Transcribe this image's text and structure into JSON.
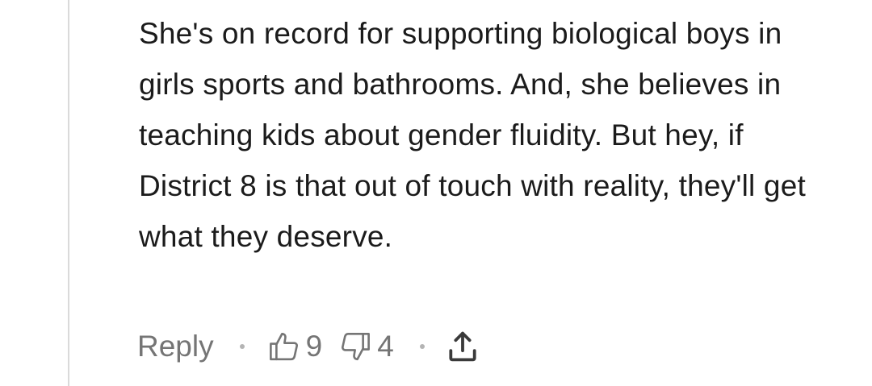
{
  "comment": {
    "text": "She's on record for supporting biological boys in girls sports and bathrooms. And, she believes in teaching kids about gender fluidity. But hey, if District 8 is that out of touch with reality, they'll get what they deserve."
  },
  "actions": {
    "reply_label": "Reply",
    "like_count": "9",
    "dislike_count": "4",
    "like_icon": "thumbs-up-icon",
    "dislike_icon": "thumbs-down-icon",
    "share_icon": "share-icon"
  },
  "colors": {
    "text": "#1b1b1b",
    "muted": "#757575",
    "thread_line": "#dadada"
  }
}
